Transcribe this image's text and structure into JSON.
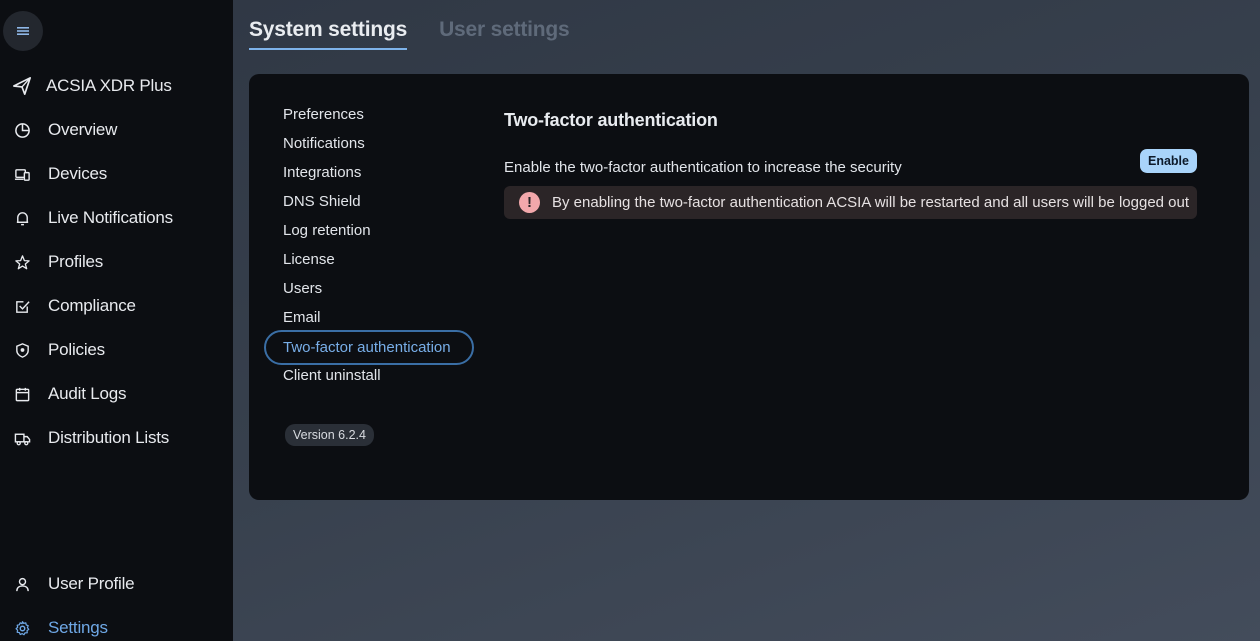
{
  "sidebar": {
    "brand": {
      "label": "ACSIA XDR Plus",
      "icon": "paper-plane-logo-icon"
    },
    "items": [
      {
        "label": "Overview",
        "icon": "pie-chart-icon"
      },
      {
        "label": "Devices",
        "icon": "devices-icon"
      },
      {
        "label": "Live Notifications",
        "icon": "bell-icon"
      },
      {
        "label": "Profiles",
        "icon": "star-icon"
      },
      {
        "label": "Compliance",
        "icon": "checkbox-icon"
      },
      {
        "label": "Policies",
        "icon": "shield-icon"
      },
      {
        "label": "Audit Logs",
        "icon": "calendar-icon"
      },
      {
        "label": "Distribution Lists",
        "icon": "truck-icon"
      }
    ],
    "bottom": [
      {
        "label": "User Profile",
        "icon": "user-icon"
      },
      {
        "label": "Settings",
        "icon": "gear-icon",
        "active": true
      }
    ]
  },
  "tabs": [
    {
      "label": "System settings",
      "active": true
    },
    {
      "label": "User settings",
      "active": false
    }
  ],
  "submenu": [
    "Preferences",
    "Notifications",
    "Integrations",
    "DNS Shield",
    "Log retention",
    "License",
    "Users",
    "Email",
    "Two-factor authentication",
    "Client uninstall"
  ],
  "active_submenu": "Two-factor authentication",
  "version": "Version 6.2.4",
  "content": {
    "title": "Two-factor authentication",
    "description": "Enable the two-factor authentication to increase the security",
    "enable_label": "Enable",
    "alert_text": "By enabling the two-factor authentication ACSIA will be restarted and all users will be logged out"
  },
  "colors": {
    "accent": "#6fa8e6",
    "enable_button": "#a9d4fa",
    "alert_icon": "#f2a8ab"
  }
}
